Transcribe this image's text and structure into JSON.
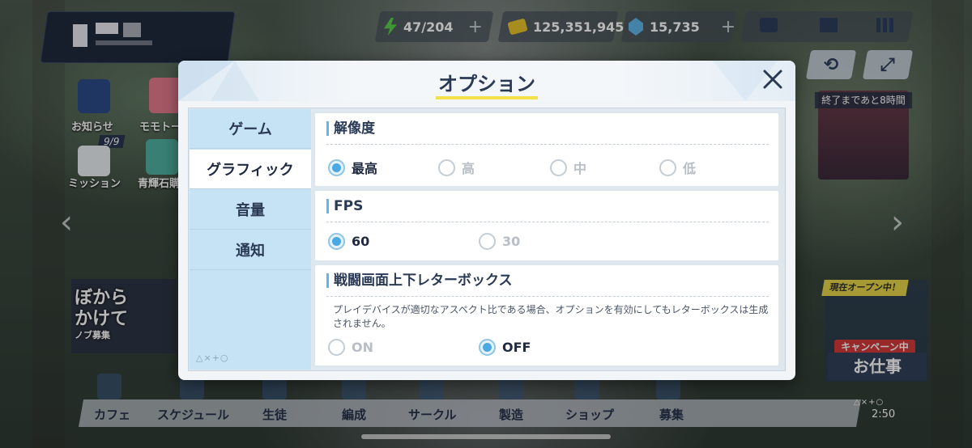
{
  "hud": {
    "energy": "47/204",
    "credits": "125,351,945",
    "gems": "15,735",
    "plus": "+"
  },
  "home": {
    "notice_label": "お知らせ",
    "momotalk_label": "モモトーク",
    "mission_label": "ミッション",
    "mission_badge": "9/9",
    "shop_label": "青輝石購入",
    "event_timer": "終了まであと8時間",
    "campaign_top": "現在オープン中！",
    "campaign_red": "キャンペーン中",
    "campaign_main": "お仕事",
    "promo_text_1": "ぼから",
    "promo_text_2": "かけて",
    "promo_small": "ノブ募集"
  },
  "bottom_nav": {
    "items": [
      "カフェ",
      "スケジュール",
      "生徒",
      "編成",
      "サークル",
      "製造",
      "ショップ",
      "募集"
    ],
    "clock": "2:50",
    "symbols": "△×+○"
  },
  "dialog": {
    "title": "オプション",
    "tabs": [
      {
        "label": "ゲーム",
        "active": false
      },
      {
        "label": "グラフィック",
        "active": true
      },
      {
        "label": "音量",
        "active": false
      },
      {
        "label": "通知",
        "active": false
      }
    ],
    "tab_footer": "△×+○",
    "sections": {
      "resolution": {
        "title": "解像度",
        "options": [
          "最高",
          "高",
          "中",
          "低"
        ],
        "selected": "最高"
      },
      "fps": {
        "title": "FPS",
        "options": [
          "60",
          "30"
        ],
        "selected": "60"
      },
      "letterbox": {
        "title": "戦闘画面上下レターボックス",
        "note": "プレイデバイスが適切なアスペクト比である場合、オプションを有効にしてもレターボックスは生成されません。",
        "options": [
          "ON",
          "OFF"
        ],
        "selected": "OFF"
      }
    }
  },
  "colors": {
    "accent": "#4aa8e2",
    "title_underline": "#f2e14a",
    "tab_bg": "#c6e3f5",
    "text_dark": "#2a3a55"
  }
}
